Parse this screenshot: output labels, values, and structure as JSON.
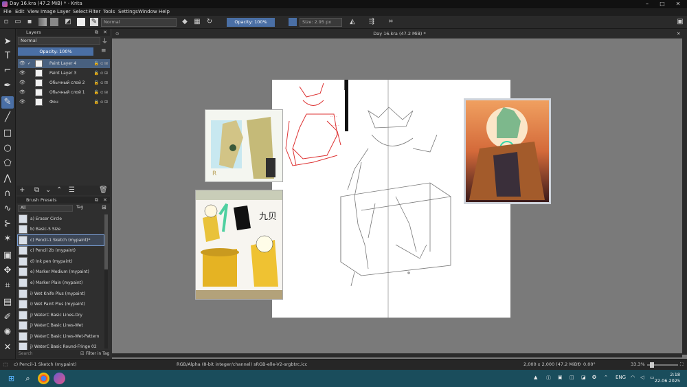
{
  "window": {
    "title": "Day 16.kra (47.2 MiB) * - Krita",
    "minimize": "–",
    "maximize": "□",
    "close": "✕"
  },
  "menu": [
    "File",
    "Edit",
    "View",
    "Image",
    "Layer",
    "Select",
    "Filter",
    "Tools",
    "Settings",
    "Window",
    "Help"
  ],
  "toolbar": {
    "blend_mode": "Normal",
    "opacity": "Opacity: 100%",
    "size": "Size: 2.95 px"
  },
  "layers_panel": {
    "title": "Layers",
    "blend_mode": "Normal",
    "opacity": "Opacity: 100%",
    "layers": [
      {
        "name": "Paint Layer 4",
        "selected": true,
        "locked": false
      },
      {
        "name": "Paint Layer 3",
        "selected": false,
        "locked": false
      },
      {
        "name": "Обычный слой 2",
        "selected": false,
        "locked": false
      },
      {
        "name": "Обычный слой 1",
        "selected": false,
        "locked": false
      },
      {
        "name": "Фон",
        "selected": false,
        "locked": true
      }
    ]
  },
  "brush_panel": {
    "title": "Brush Presets",
    "filter": "All",
    "tag": "Tag",
    "presets": [
      "a) Eraser Circle",
      "b) Basic-5 Size",
      "c) Pencil-1 Sketch (mypaint)*",
      "c) Pencil 2b (mypaint)",
      "d) Ink pen (mypaint)",
      "e) Marker Medium (mypaint)",
      "e) Marker Plain (mypaint)",
      "i) Wet Knife Plus (mypaint)",
      "i) Wet Paint Plus (mypaint)",
      "j) WaterC Basic Lines-Dry",
      "j) WaterC Basic Lines-Wet",
      "j) WaterC Basic Lines-Wet-Pattern",
      "j) WaterC Basic Round-Fringe 02"
    ],
    "selected_index": 2,
    "search_placeholder": "Search",
    "filter_in_tag": "Filter in Tag"
  },
  "document": {
    "tab_title": "Day 16.kra (47.2 MiB) *"
  },
  "statusbar": {
    "brush": "c) Pencil-1 Sketch (mypaint)",
    "color_info": "RGB/Alpha (8-bit integer/channel)  sRGB-elle-V2-srgbtrc.icc",
    "dimensions": "2,000 x 2,000 (47.2 MiB)",
    "rotation": "0.00°",
    "zoom": "33.3%"
  },
  "taskbar": {
    "language": "ENG",
    "time": "2:18",
    "date": "22.06.2025"
  },
  "colors": {
    "accent": "#4a6fa5",
    "canvas_bg": "#7a7a7a",
    "taskbar": "#1a4d5c"
  }
}
